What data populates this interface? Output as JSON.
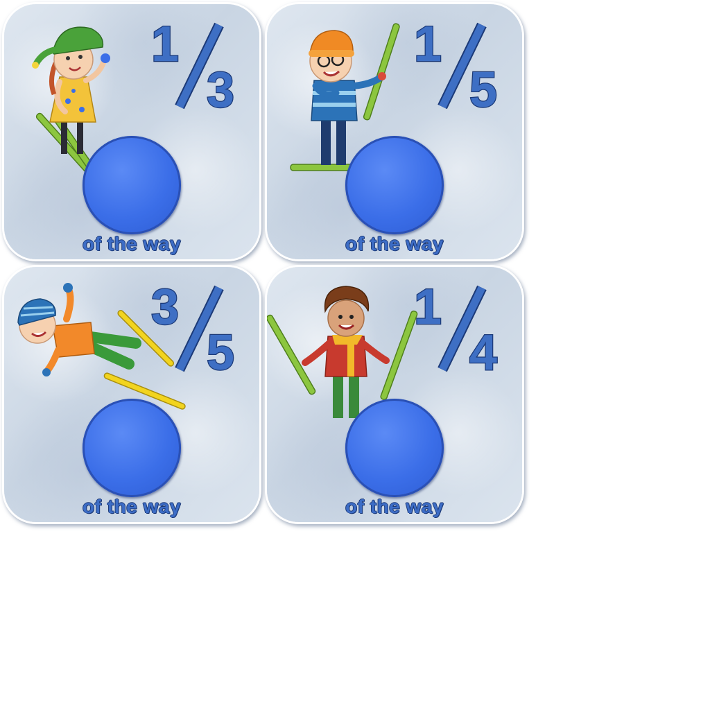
{
  "cards": [
    {
      "numerator": "1",
      "denominator": "3",
      "caption": "of the way",
      "character": "girl-skier-icon"
    },
    {
      "numerator": "1",
      "denominator": "5",
      "caption": "of the way",
      "character": "boy-with-glasses-skier-icon"
    },
    {
      "numerator": "3",
      "denominator": "5",
      "caption": "of the way",
      "character": "falling-skier-icon"
    },
    {
      "numerator": "1",
      "denominator": "4",
      "caption": "of the way",
      "character": "boy-holding-skis-icon"
    }
  ],
  "colors": {
    "ball": "#3b6ee8",
    "text": "#3e6fc4",
    "outline": "#1c3a78",
    "ski_green": "#8cc63f",
    "ski_yellow": "#f2d41f"
  }
}
